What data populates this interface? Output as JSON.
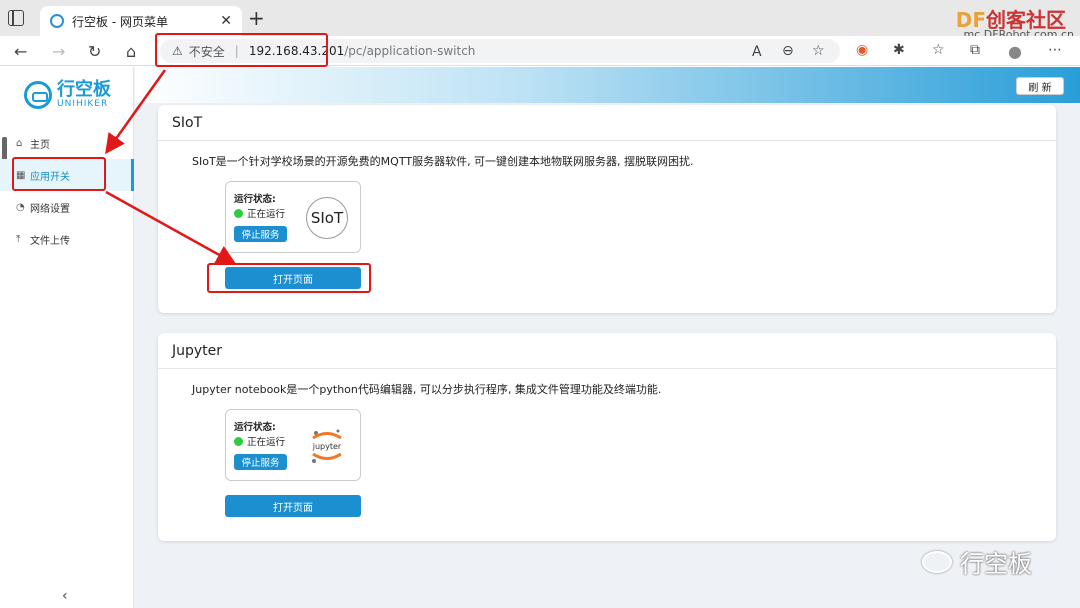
{
  "browser": {
    "tab_title": "行空板 - 网页菜单",
    "tab_close": "✕",
    "new_tab": "+",
    "security_label": "不安全",
    "url_host": "192.168.43.201",
    "url_path": "/pc/application-switch",
    "watermark_brand_df": "DF",
    "watermark_brand": "创客社区",
    "watermark_site": "mc.DFRobot.com.cn"
  },
  "sidebar": {
    "logo_title": "行空板",
    "logo_subtitle": "UNIHIKER",
    "items": [
      {
        "label": "主页",
        "icon": "home-icon",
        "glyph": "⌂"
      },
      {
        "label": "应用开关",
        "icon": "grid-icon",
        "glyph": "▦"
      },
      {
        "label": "网络设置",
        "icon": "wifi-icon",
        "glyph": "◔"
      },
      {
        "label": "文件上传",
        "icon": "upload-icon",
        "glyph": "⤒"
      }
    ],
    "active_index": 1,
    "collapse": "‹"
  },
  "header": {
    "refresh_label": "刷 新"
  },
  "apps": [
    {
      "name": "SIoT",
      "description": "SIoT是一个针对学校场景的开源免费的MQTT服务器软件, 可一键创建本地物联网服务器, 摆脱联网困扰.",
      "status_label": "运行状态:",
      "status_value": "正在运行",
      "stop_label": "停止服务",
      "logo_text": "SIoT",
      "open_label": "打开页面"
    },
    {
      "name": "Jupyter",
      "description": "Jupyter notebook是一个python代码编辑器, 可以分步执行程序, 集成文件管理功能及终端功能.",
      "status_label": "运行状态:",
      "status_value": "正在运行",
      "stop_label": "停止服务",
      "logo_text": "jupyter",
      "open_label": "打开页面"
    }
  ],
  "watermark_bottom": "行空板",
  "colors": {
    "accent": "#1b8fcf",
    "annotation": "#e01818",
    "running": "#2ecc40"
  }
}
